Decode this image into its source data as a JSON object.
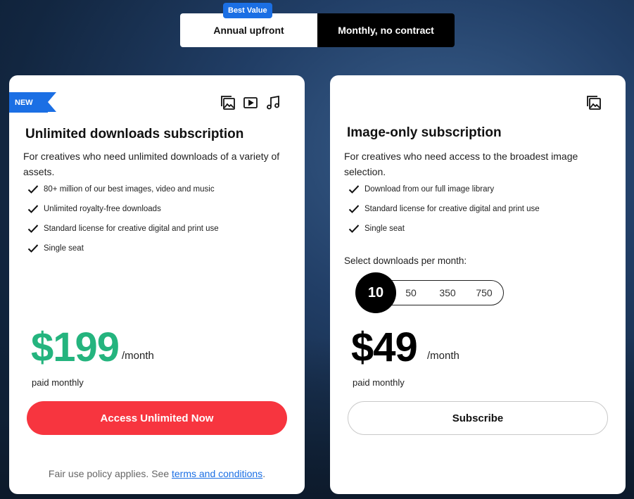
{
  "toggle": {
    "badge": "Best Value",
    "annual_label": "Annual upfront",
    "monthly_label": "Monthly, no contract",
    "selected": "Monthly, no contract"
  },
  "plans": [
    {
      "ribbon": "NEW",
      "icons": [
        "image-icon",
        "video-icon",
        "music-icon"
      ],
      "title": "Unlimited downloads subscription",
      "description": "For creatives who need unlimited downloads of a variety of assets.",
      "features": [
        "80+ million of our best images, video and music",
        "Unlimited royalty-free downloads",
        "Standard license for creative digital and print use",
        "Single seat"
      ],
      "price": "$199",
      "per": "/month",
      "billing": "paid monthly",
      "cta": "Access Unlimited Now",
      "fair_text": "Fair use policy applies. See ",
      "fair_link": "terms and conditions",
      "fair_end": "."
    },
    {
      "icons": [
        "image-icon"
      ],
      "title": "Image-only subscription",
      "description": "For creatives who need access to the broadest image selection.",
      "features": [
        "Download from our full image library",
        "Standard license for creative digital and print use",
        "Single seat"
      ],
      "select_label": "Select downloads per month:",
      "download_options": [
        "10",
        "50",
        "350",
        "750"
      ],
      "selected_option": "10",
      "price": "$49",
      "per": "/month",
      "billing": "paid monthly",
      "cta": "Subscribe"
    }
  ],
  "colors": {
    "accent_blue": "#1b6fe4",
    "price_green": "#24b47e",
    "cta_red": "#f7353f"
  }
}
